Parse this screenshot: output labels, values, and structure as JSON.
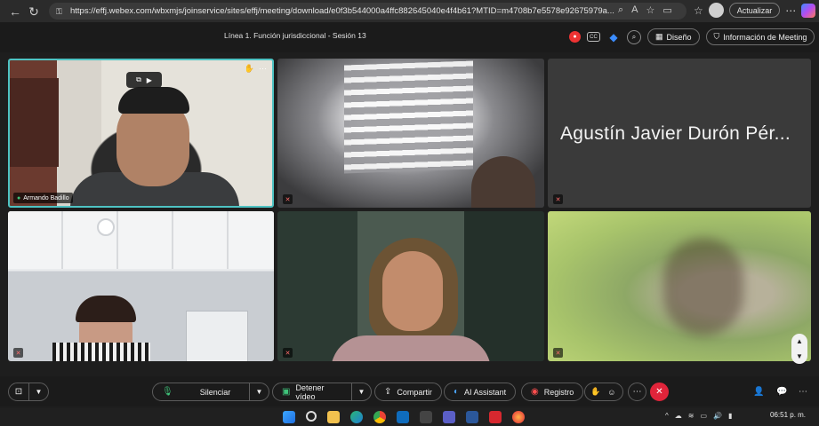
{
  "browser": {
    "url": "https://effj.webex.com/wbxmjs/joinservice/sites/effj/meeting/download/e0f3b544000a4ffc882645040e4f4b61?MTID=m4708b7e5578e92675979a...",
    "update_label": "Actualizar"
  },
  "meeting": {
    "title": "Línea 1. Función jurisdiccional - Sesión 13",
    "layout_label": "Diseño",
    "info_label": "Información de Meeting"
  },
  "participants": [
    {
      "name": "Armando Badillo",
      "active_speaker": true
    },
    {
      "name": "",
      "muted": true
    },
    {
      "name": "Agustín Javier Durón Pér...",
      "muted": true,
      "video": false
    },
    {
      "name": "",
      "muted": true
    },
    {
      "name": "",
      "muted": true
    },
    {
      "name": "",
      "muted": true
    }
  ],
  "controls": {
    "mute_label": "Silenciar",
    "video_label": "Detener vídeo",
    "share_label": "Compartir",
    "ai_label": "AI Assistant",
    "record_label": "Registro"
  },
  "taskbar": {
    "time": "06:51 p. m."
  },
  "colors": {
    "active_border": "#4ec3c3",
    "end_call": "#e0243a",
    "mic_green": "#3fc47a"
  }
}
